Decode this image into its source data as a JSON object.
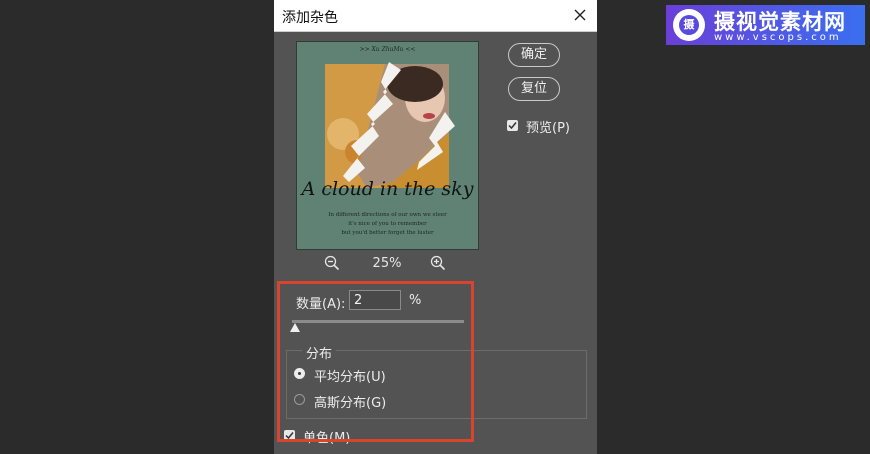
{
  "dialog": {
    "title": "添加杂色",
    "close_icon": "close-icon",
    "ok_label": "确定",
    "reset_label": "复位",
    "preview_label": "预览(P)",
    "preview_checked": true
  },
  "preview_image": {
    "header_text": ">>      Xu  ZhuMu      <<",
    "headline": "A cloud in the sky",
    "body_lines": [
      "In different directions of our own we steer",
      "it's nice of you to remember",
      "but you'd better forget the luster"
    ]
  },
  "zoom": {
    "zoom_out_icon": "zoom-out-icon",
    "zoom_in_icon": "zoom-in-icon",
    "level": "25%"
  },
  "amount": {
    "label": "数量(A):",
    "value": "2",
    "unit": "%",
    "slider_value_percent": 2
  },
  "distribution": {
    "group_title": "分布",
    "options": [
      {
        "label": "平均分布(U)",
        "selected": true
      },
      {
        "label": "高斯分布(G)",
        "selected": false
      }
    ]
  },
  "monochromatic": {
    "label": "单色(M)",
    "checked": true
  },
  "watermark": {
    "title": "摄视觉素材网",
    "url": "www.vscops.com",
    "mark_char": "摄"
  },
  "colors": {
    "highlight": "#d9442c",
    "dialog_bg": "#535353",
    "logo_gradient_start": "#6a3fd8",
    "logo_gradient_end": "#3a6ff0"
  }
}
